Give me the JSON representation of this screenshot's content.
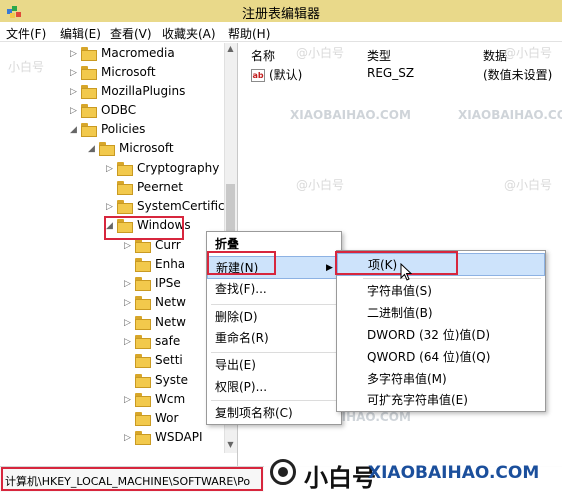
{
  "window": {
    "title": "注册表编辑器"
  },
  "menu": [
    "文件(F)",
    "编辑(E)",
    "查看(V)",
    "收藏夹(A)",
    "帮助(H)"
  ],
  "tree": [
    {
      "label": "Macromedia",
      "arrow": "▷"
    },
    {
      "label": "Microsoft",
      "arrow": "▷"
    },
    {
      "label": "MozillaPlugins",
      "arrow": "▷"
    },
    {
      "label": "ODBC",
      "arrow": "▷"
    },
    {
      "label": "Policies",
      "arrow": "◢"
    },
    {
      "label": "Microsoft",
      "arrow": "◢"
    },
    {
      "label": "Cryptography",
      "arrow": "▷"
    },
    {
      "label": "Peernet",
      "arrow": ""
    },
    {
      "label": "SystemCertifica",
      "arrow": "▷"
    },
    {
      "label": "Windows",
      "arrow": "◢"
    },
    {
      "label": "Curr",
      "arrow": "▷"
    },
    {
      "label": "Enha",
      "arrow": ""
    },
    {
      "label": "IPSe",
      "arrow": "▷"
    },
    {
      "label": "Netw",
      "arrow": "▷"
    },
    {
      "label": "Netw",
      "arrow": "▷"
    },
    {
      "label": "safe",
      "arrow": "▷"
    },
    {
      "label": "Setti",
      "arrow": ""
    },
    {
      "label": "Syste",
      "arrow": ""
    },
    {
      "label": "Wcm",
      "arrow": "▷"
    },
    {
      "label": "Wor",
      "arrow": ""
    },
    {
      "label": "WSDAPI",
      "arrow": "▷"
    }
  ],
  "list": {
    "headers": [
      "名称",
      "类型",
      "数据"
    ],
    "rows": [
      {
        "name": "(默认)",
        "type": "REG_SZ",
        "data": "(数值未设置)",
        "icon": "ab"
      }
    ]
  },
  "context_menu": [
    "折叠",
    "新建(N)",
    "查找(F)...",
    "删除(D)",
    "重命名(R)",
    "导出(E)",
    "权限(P)...",
    "复制项名称(C)"
  ],
  "submenu": [
    "项(K)",
    "字符串值(S)",
    "二进制值(B)",
    "DWORD (32 位)值(D)",
    "QWORD (64 位)值(Q)",
    "多字符串值(M)",
    "可扩充字符串值(E)"
  ],
  "status": "计算机\\HKEY_LOCAL_MACHINE\\SOFTWARE\\Po",
  "watermark": {
    "handle": "@小白号",
    "url": "XIAOBAIHAO.COM",
    "small": "小白号"
  },
  "banner": {
    "text": "小白号",
    "url": "XIAOBAIHAO.COM"
  },
  "colors": {
    "titlebar": "#e9d98a",
    "highlight": "#cde3fb",
    "redbox": "#d7263d",
    "folder": "#f2c94c"
  }
}
